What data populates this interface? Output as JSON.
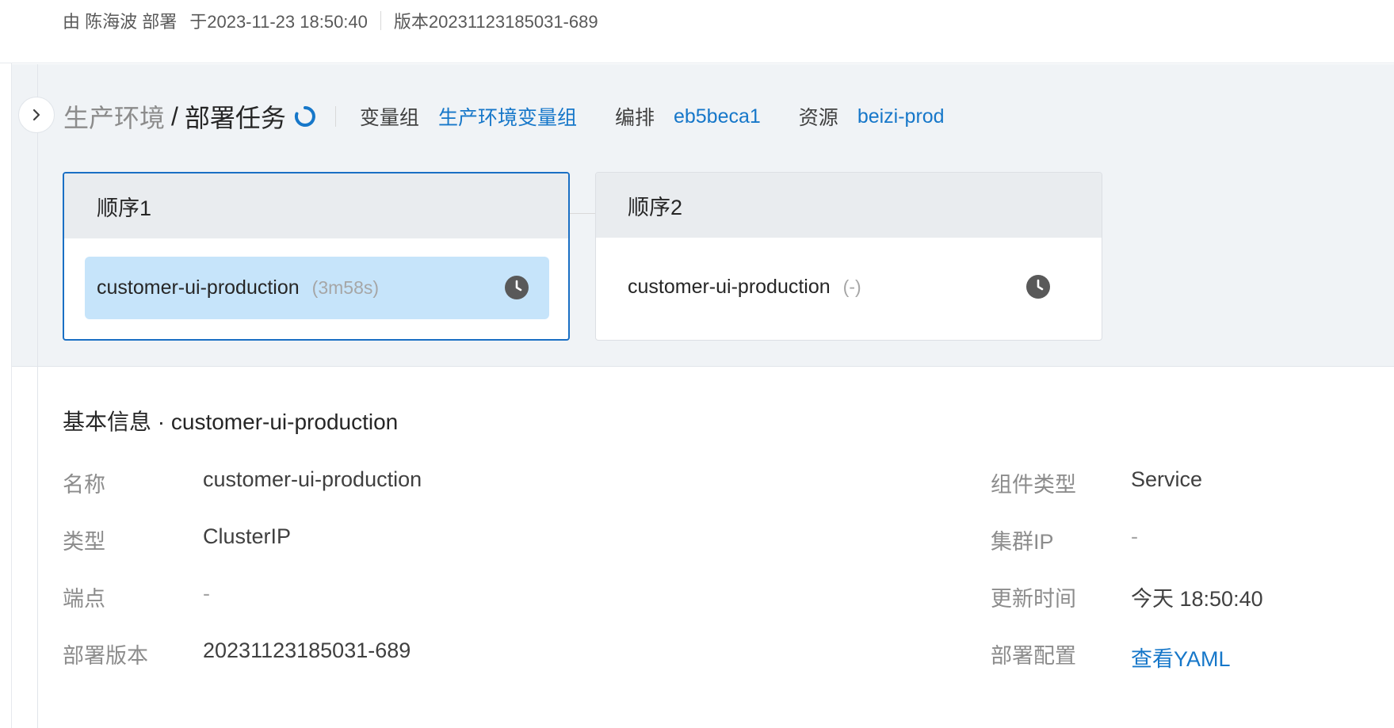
{
  "deploy_meta": {
    "by": "由 陈海波 部署",
    "at": "于2023-11-23 18:50:40",
    "version": "版本20231123185031-689"
  },
  "header": {
    "env": "生产环境",
    "slash": "/",
    "page": "部署任务",
    "var_group_label": "变量组",
    "var_group_value": "生产环境变量组",
    "orchestration_label": "编排",
    "orchestration_value": "eb5beca1",
    "resource_label": "资源",
    "resource_value": "beizi-prod"
  },
  "stages": [
    {
      "title": "顺序1",
      "task": "customer-ui-production",
      "duration": "(3m58s)",
      "status_icon": "clock-icon",
      "selected": true
    },
    {
      "title": "顺序2",
      "task": "customer-ui-production",
      "duration": "(-)",
      "status_icon": "clock-icon",
      "selected": false
    }
  ],
  "info": {
    "title": "基本信息 · customer-ui-production",
    "rows": [
      {
        "k1": "名称",
        "v1": "customer-ui-production",
        "k2": "组件类型",
        "v2": "Service"
      },
      {
        "k1": "类型",
        "v1": "ClusterIP",
        "k2": "集群IP",
        "v2": "-"
      },
      {
        "k1": "端点",
        "v1": "-",
        "k2": "更新时间",
        "v2": "今天 18:50:40"
      },
      {
        "k1": "部署版本",
        "v1": "20231123185031-689",
        "k2": "部署配置",
        "v2": "查看YAML"
      }
    ]
  },
  "colors": {
    "accent": "#1677c9",
    "selected_border": "#1a6fc4",
    "selected_task_bg": "#c6e4fa",
    "panel_bg": "#f0f3f6"
  }
}
